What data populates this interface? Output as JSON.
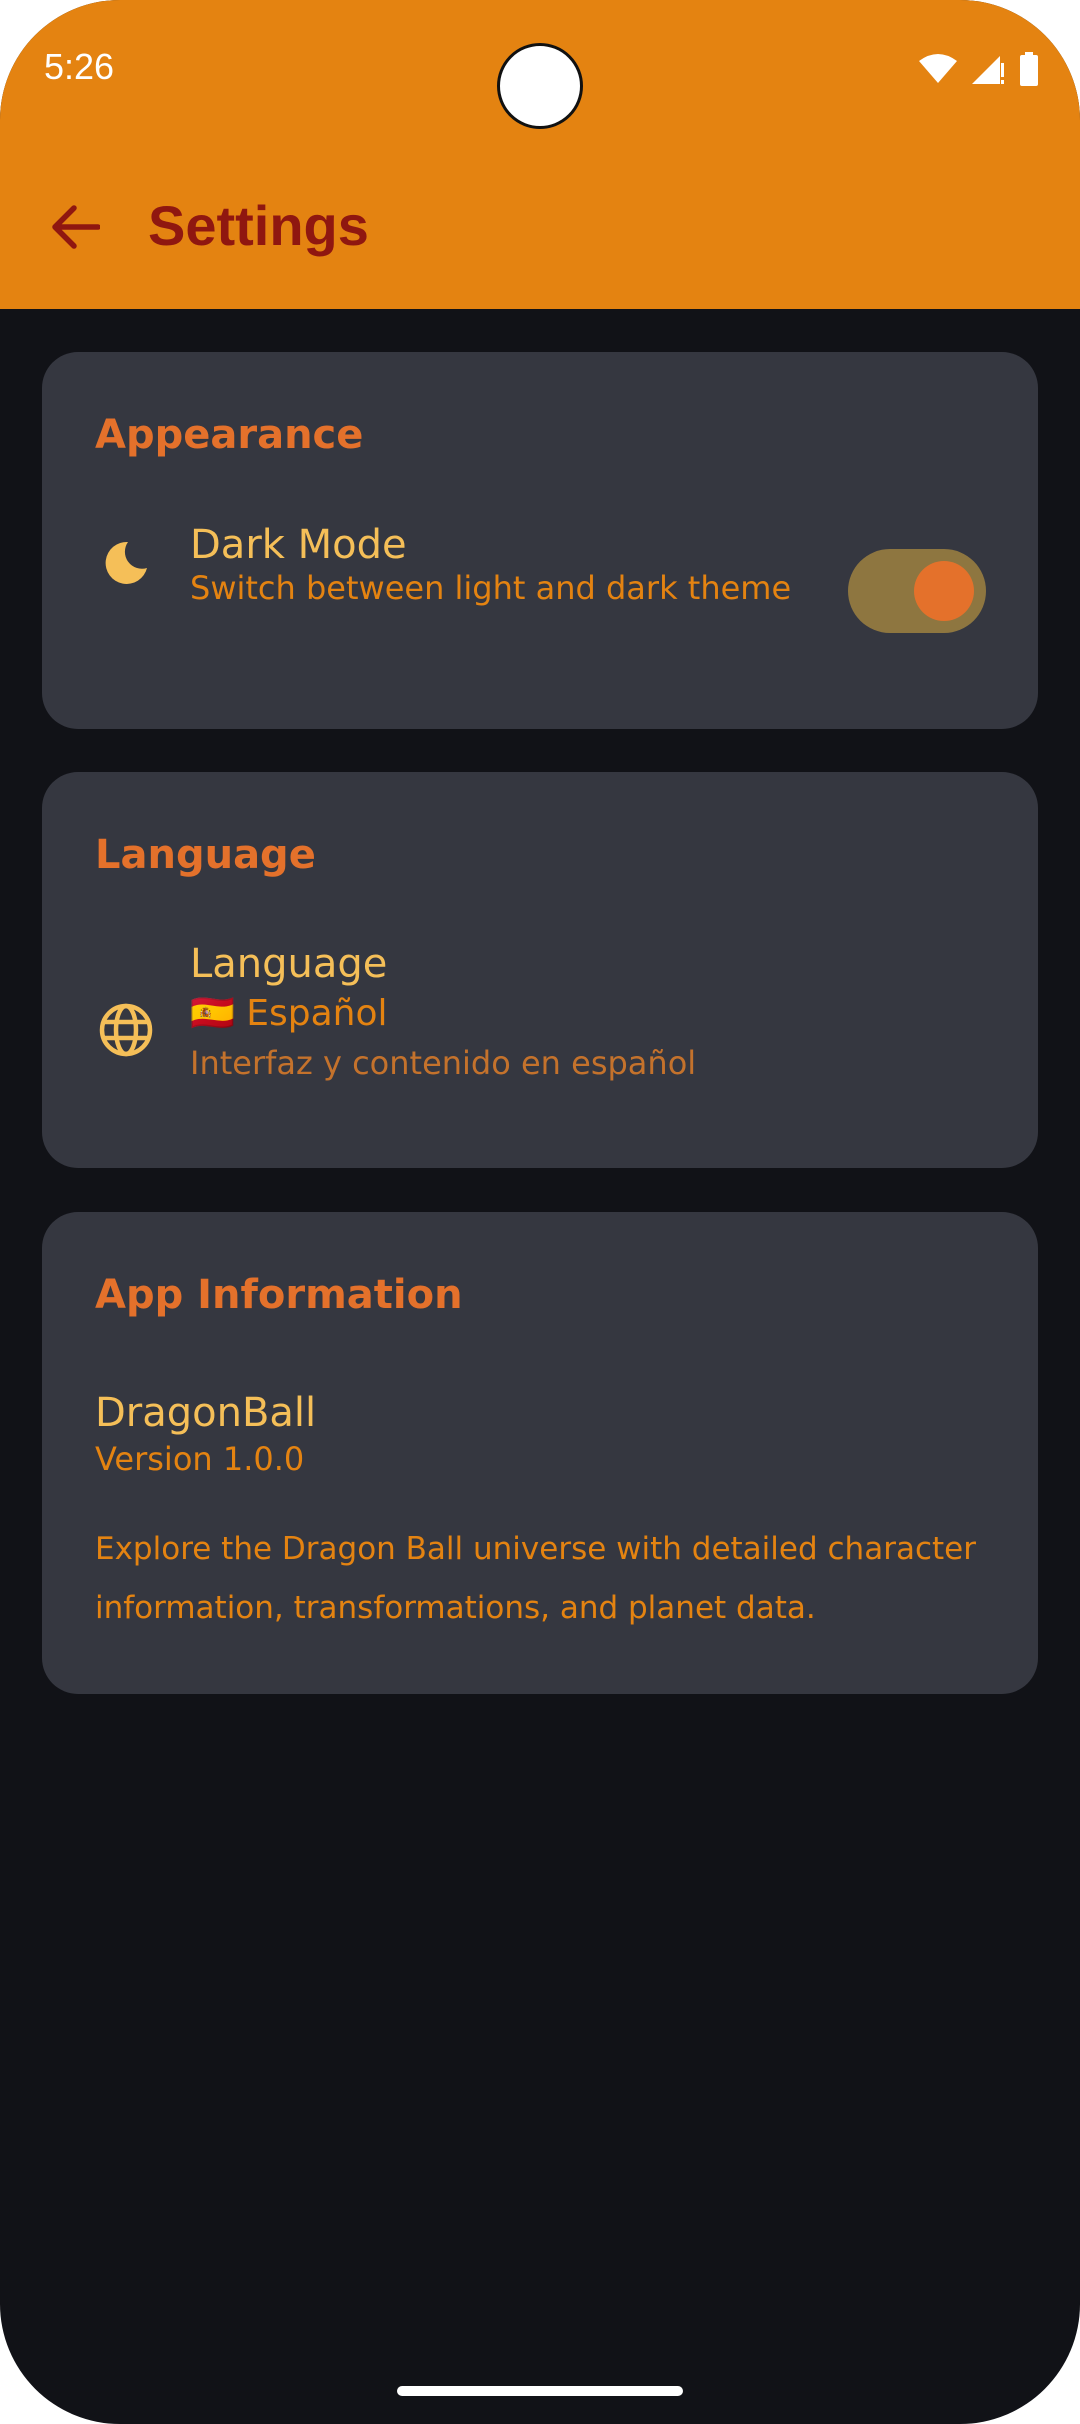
{
  "status_bar": {
    "time": "5:26",
    "icons": [
      "wifi-icon",
      "signal-icon",
      "battery-icon"
    ]
  },
  "app_bar": {
    "back_icon": "arrow-back-icon",
    "title": "Settings"
  },
  "appearance": {
    "header": "Appearance",
    "dark_mode": {
      "icon": "moon-icon",
      "title": "Dark Mode",
      "subtitle": "Switch between light and dark theme",
      "enabled": true
    }
  },
  "language": {
    "header": "Language",
    "item": {
      "icon": "globe-icon",
      "title": "Language",
      "current": "🇪🇸 Español",
      "description": "Interfaz y contenido en español"
    }
  },
  "app_info": {
    "header": "App Information",
    "app_name": "DragonBall",
    "version": "Version 1.0.0",
    "description": "Explore the Dragon Ball universe with detailed character information, transformations, and planet data."
  },
  "colors": {
    "app_bar": "#e48311",
    "title": "#8f1710",
    "background": "#111217",
    "card": "#353740",
    "header_text": "#e4712b",
    "item_title": "#f5bf58",
    "item_sub": "#e48311",
    "toggle_track": "#8e7640",
    "toggle_knob": "#e4712b"
  }
}
